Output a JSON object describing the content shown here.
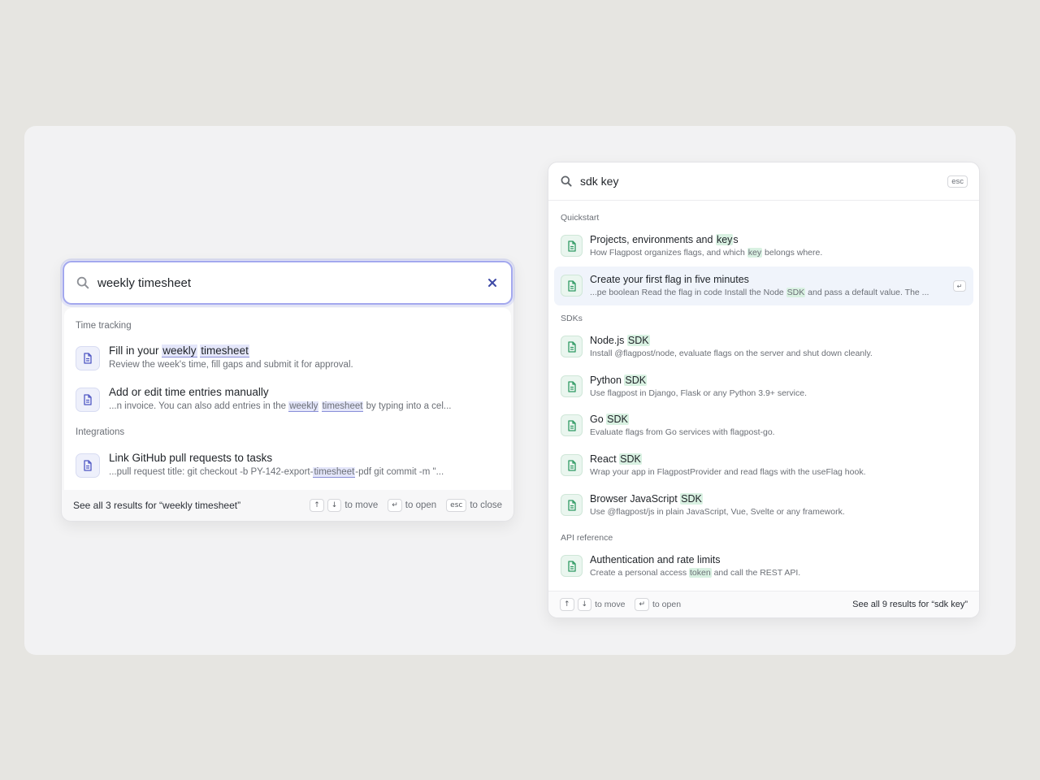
{
  "left": {
    "query": "weekly timesheet",
    "sections": [
      {
        "label": "Time tracking",
        "items": [
          {
            "title": [
              {
                "t": "Fill in your "
              },
              {
                "t": "weekly",
                "hl": true
              },
              {
                "t": " "
              },
              {
                "t": "timesheet",
                "hl": true
              }
            ],
            "desc": [
              {
                "t": "Review the week's time, fill gaps and submit it for approval."
              }
            ]
          },
          {
            "title": [
              {
                "t": "Add or edit time entries manually"
              }
            ],
            "desc": [
              {
                "t": "...n invoice. You can also add entries in the "
              },
              {
                "t": "weekly",
                "hl": true
              },
              {
                "t": " "
              },
              {
                "t": "timesheet",
                "hl": true
              },
              {
                "t": " by typing into a cel..."
              }
            ]
          }
        ]
      },
      {
        "label": "Integrations",
        "items": [
          {
            "title": [
              {
                "t": "Link GitHub pull requests to tasks"
              }
            ],
            "desc": [
              {
                "t": "...pull request title: git checkout -b PY-142-export-"
              },
              {
                "t": "timesheet",
                "hl": true
              },
              {
                "t": "-pdf git commit -m \"..."
              }
            ]
          }
        ]
      }
    ],
    "footer": {
      "see_all": "See all 3 results for “weekly timesheet”",
      "key_up": "↑",
      "key_down": "↓",
      "move_label": "to move",
      "key_enter": "↵",
      "open_label": "to open",
      "key_esc": "esc",
      "close_label": "to close"
    }
  },
  "right": {
    "query": "sdk key",
    "esc_label": "esc",
    "sections": [
      {
        "label": "Quickstart",
        "items": [
          {
            "title": [
              {
                "t": "Projects, environments and "
              },
              {
                "t": "key",
                "hl": true
              },
              {
                "t": "s"
              }
            ],
            "desc": [
              {
                "t": "How Flagpost organizes flags, and which "
              },
              {
                "t": "key",
                "hl": true
              },
              {
                "t": " belongs where."
              }
            ]
          },
          {
            "active": true,
            "title": [
              {
                "t": "Create your first flag in five minutes"
              }
            ],
            "desc": [
              {
                "t": "...pe boolean Read the flag in code Install the Node "
              },
              {
                "t": "SDK",
                "hl": true
              },
              {
                "t": " and pass a default value. The ..."
              }
            ]
          }
        ]
      },
      {
        "label": "SDKs",
        "items": [
          {
            "title": [
              {
                "t": "Node.js "
              },
              {
                "t": "SDK",
                "hl": true
              }
            ],
            "desc": [
              {
                "t": "Install @flagpost/node, evaluate flags on the server and shut down cleanly."
              }
            ]
          },
          {
            "title": [
              {
                "t": "Python "
              },
              {
                "t": "SDK",
                "hl": true
              }
            ],
            "desc": [
              {
                "t": "Use flagpost in Django, Flask or any Python 3.9+ service."
              }
            ]
          },
          {
            "title": [
              {
                "t": "Go "
              },
              {
                "t": "SDK",
                "hl": true
              }
            ],
            "desc": [
              {
                "t": "Evaluate flags from Go services with flagpost-go."
              }
            ]
          },
          {
            "title": [
              {
                "t": "React "
              },
              {
                "t": "SDK",
                "hl": true
              }
            ],
            "desc": [
              {
                "t": "Wrap your app in FlagpostProvider and read flags with the useFlag hook."
              }
            ]
          },
          {
            "title": [
              {
                "t": "Browser JavaScript "
              },
              {
                "t": "SDK",
                "hl": true
              }
            ],
            "desc": [
              {
                "t": "Use @flagpost/js in plain JavaScript, Vue, Svelte or any framework."
              }
            ]
          }
        ]
      },
      {
        "label": "API reference",
        "items": [
          {
            "title": [
              {
                "t": "Authentication and rate limits"
              }
            ],
            "desc": [
              {
                "t": "Create a personal access "
              },
              {
                "t": "token",
                "hl": true
              },
              {
                "t": " and call the REST API."
              }
            ]
          }
        ]
      }
    ],
    "footer": {
      "key_up": "↑",
      "key_down": "↓",
      "move_label": "to move",
      "key_enter": "↵",
      "open_label": "to open",
      "see_all": "See all 9 results for “sdk key”"
    }
  },
  "colors": {
    "left_accent": "#a3a8ee",
    "left_highlight": "#e4e6fa",
    "right_highlight": "#d9f1e2",
    "right_icon": "#2f9a63",
    "left_icon": "#4f57c4"
  }
}
